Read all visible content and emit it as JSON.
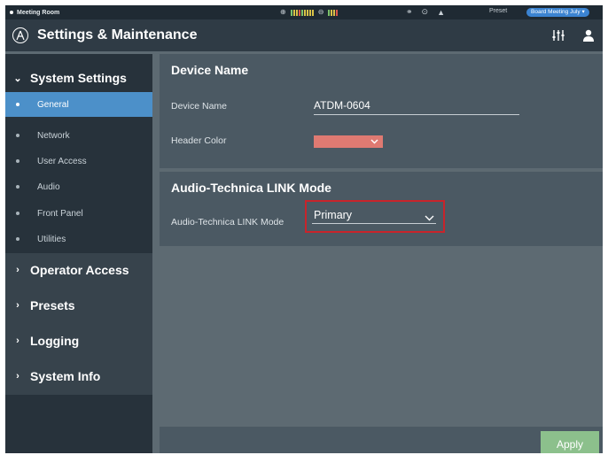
{
  "status_bar": {
    "room_name": "Meeting Room",
    "preset_label": "Preset",
    "preset_value": "Board Meeting July"
  },
  "header": {
    "title": "Settings & Maintenance",
    "icons": [
      "mixer-sliders-icon",
      "user-icon"
    ]
  },
  "sidebar": {
    "groups": [
      {
        "label": "System Settings",
        "expanded": true,
        "items": [
          {
            "label": "General",
            "active": true
          },
          {
            "label": "Network",
            "active": false
          },
          {
            "label": "User Access",
            "active": false
          },
          {
            "label": "Audio",
            "active": false
          },
          {
            "label": "Front Panel",
            "active": false
          },
          {
            "label": "Utilities",
            "active": false
          }
        ]
      },
      {
        "label": "Operator Access",
        "expanded": false
      },
      {
        "label": "Presets",
        "expanded": false
      },
      {
        "label": "Logging",
        "expanded": false
      },
      {
        "label": "System Info",
        "expanded": false
      }
    ]
  },
  "device_name_panel": {
    "title": "Device Name",
    "device_name_label": "Device Name",
    "device_name_value": "ATDM-0604",
    "header_color_label": "Header Color",
    "header_color_value": "#df7a72"
  },
  "link_mode_panel": {
    "title": "Audio-Technica LINK Mode",
    "mode_label": "Audio-Technica LINK Mode",
    "mode_value": "Primary"
  },
  "footer": {
    "apply_label": "Apply"
  },
  "colors": {
    "accent_blue": "#4c90c9",
    "apply_green": "#8cc08c",
    "highlight_red": "#c8242b"
  }
}
